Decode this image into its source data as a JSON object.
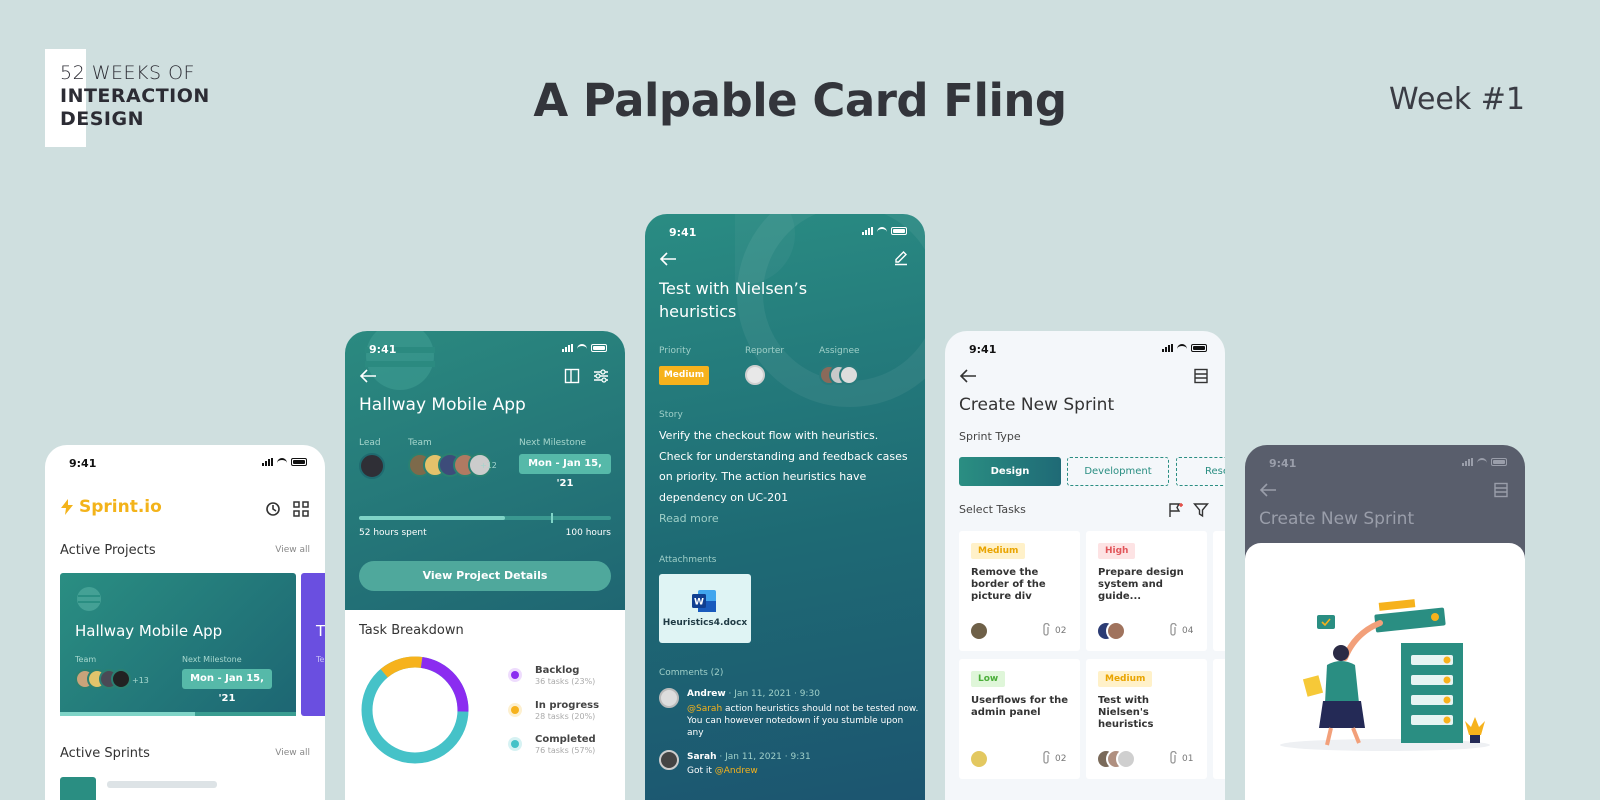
{
  "header": {
    "logo_line1": "52 WEEKS OF",
    "logo_line2": "INTERACTION",
    "logo_line3": "DESIGN",
    "title": "A Palpable Card Fling",
    "week": "Week #1"
  },
  "status_time": "9:41",
  "screen1": {
    "brand": "Sprint.io",
    "active_projects": "Active Projects",
    "view_all": "View all",
    "project_name": "Hallway Mobile App",
    "team_label": "Team",
    "next_milestone_label": "Next Milestone",
    "team_extra": "+13",
    "milestone": "Mon - Jan 15, '21",
    "active_sprints": "Active Sprints",
    "next_card_initial": "T",
    "next_card_team": "Te"
  },
  "screen2": {
    "project_name": "Hallway Mobile App",
    "lead_label": "Lead",
    "team_label": "Team",
    "team_extra": "+12",
    "next_milestone_label": "Next Milestone",
    "milestone": "Mon - Jan 15, '21",
    "progress": 0.58,
    "hours_spent": "52 hours spent",
    "hours_total": "100 hours",
    "view_details": "View Project Details",
    "task_breakdown": "Task Breakdown",
    "legend": [
      {
        "label": "Backlog",
        "sub": "36 tasks (23%)",
        "color": "#8b2cf0"
      },
      {
        "label": "In progress",
        "sub": "28 tasks (20%)",
        "color": "#f6b21c"
      },
      {
        "label": "Completed",
        "sub": "76 tasks (57%)",
        "color": "#45c2c8"
      }
    ]
  },
  "screen3": {
    "title_line1": "Test with Nielsen’s",
    "title_line2": "heuristics",
    "priority_label": "Priority",
    "reporter_label": "Reporter",
    "assignee_label": "Assignee",
    "priority": "Medium",
    "story_label": "Story",
    "story_lines": [
      "Verify the checkout flow with heuristics.",
      "Check for understanding and feedback cases",
      "on priority. The action heuristics have",
      "dependency on UC-201"
    ],
    "read_more": "Read more",
    "attachments_label": "Attachments",
    "file_name": "Heuristics4.docx",
    "comments_label": "Comments (2)",
    "comment1": {
      "author": "Andrew",
      "date": "Jan 11, 2021",
      "time": "9:30",
      "mention": "@Sarah",
      "text1": " action heuristics should not be tested now.",
      "text2": "You can however notedown if you stumble upon",
      "text3": "any"
    },
    "comment2": {
      "author": "Sarah",
      "date": "Jan 11, 2021",
      "time": "9:31",
      "text": "Got it ",
      "mention": "@Andrew"
    }
  },
  "screen4": {
    "title": "Create New Sprint",
    "sprint_type": "Sprint Type",
    "types": [
      "Design",
      "Development",
      "Rese"
    ],
    "select_tasks": "Select Tasks",
    "tasks": [
      {
        "tag": "Medium",
        "title": "Remove the border of the picture div",
        "count": "02"
      },
      {
        "tag": "High",
        "title": "Prepare design system and guide...",
        "count": "04"
      },
      {
        "tag": "Low",
        "title": "Userflows for the admin panel",
        "count": "02"
      },
      {
        "tag": "Medium",
        "title": "Test with Nielsen's heuristics",
        "count": "01"
      }
    ],
    "colors": {
      "Medium": "#fff1c9",
      "High": "#fde3e4",
      "Low": "#dff6d9"
    }
  },
  "screen5": {
    "title": "Create New Sprint"
  }
}
